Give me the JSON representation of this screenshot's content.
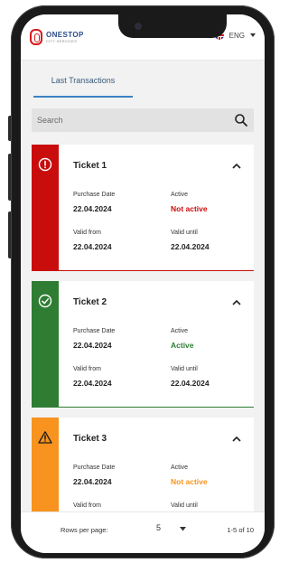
{
  "header": {
    "brand_name": "ONESTOP",
    "brand_sub": "CITY SERVICES",
    "language": "ENG"
  },
  "tabs": [
    {
      "label": "Last Transactions",
      "active": true
    }
  ],
  "search": {
    "placeholder": "Search",
    "value": ""
  },
  "tickets": [
    {
      "title": "Ticket 1",
      "status_type": "warning",
      "accent_color": "#c90d0d",
      "status_color": "#c90d0d",
      "purchase_label": "Purchase Date",
      "purchase_date": "22.04.2024",
      "active_label": "Active",
      "active_value": "Not active",
      "valid_from_label": "Valid from",
      "valid_from": "22.04.2024",
      "valid_until_label": "Valid until",
      "valid_until": "22.04.2024"
    },
    {
      "title": "Ticket 2",
      "status_type": "check",
      "accent_color": "#2e7d32",
      "status_color": "#2e7d32",
      "purchase_label": "Purchase Date",
      "purchase_date": "22.04.2024",
      "active_label": "Active",
      "active_value": "Active",
      "valid_from_label": "Valid from",
      "valid_from": "22.04.2024",
      "valid_until_label": "Valid until",
      "valid_until": "22.04.2024"
    },
    {
      "title": "Ticket 3",
      "status_type": "alert",
      "accent_color": "#f7931e",
      "status_color": "#f7931e",
      "purchase_label": "Purchase Date",
      "purchase_date": "22.04.2024",
      "active_label": "Active",
      "active_value": "Not active",
      "valid_from_label": "Valid from",
      "valid_from": "",
      "valid_until_label": "Valid until",
      "valid_until": ""
    }
  ],
  "pagination": {
    "rows_per_page_label": "Rows per page:",
    "rows_per_page": "5",
    "range_text": "1-5 of 10"
  }
}
